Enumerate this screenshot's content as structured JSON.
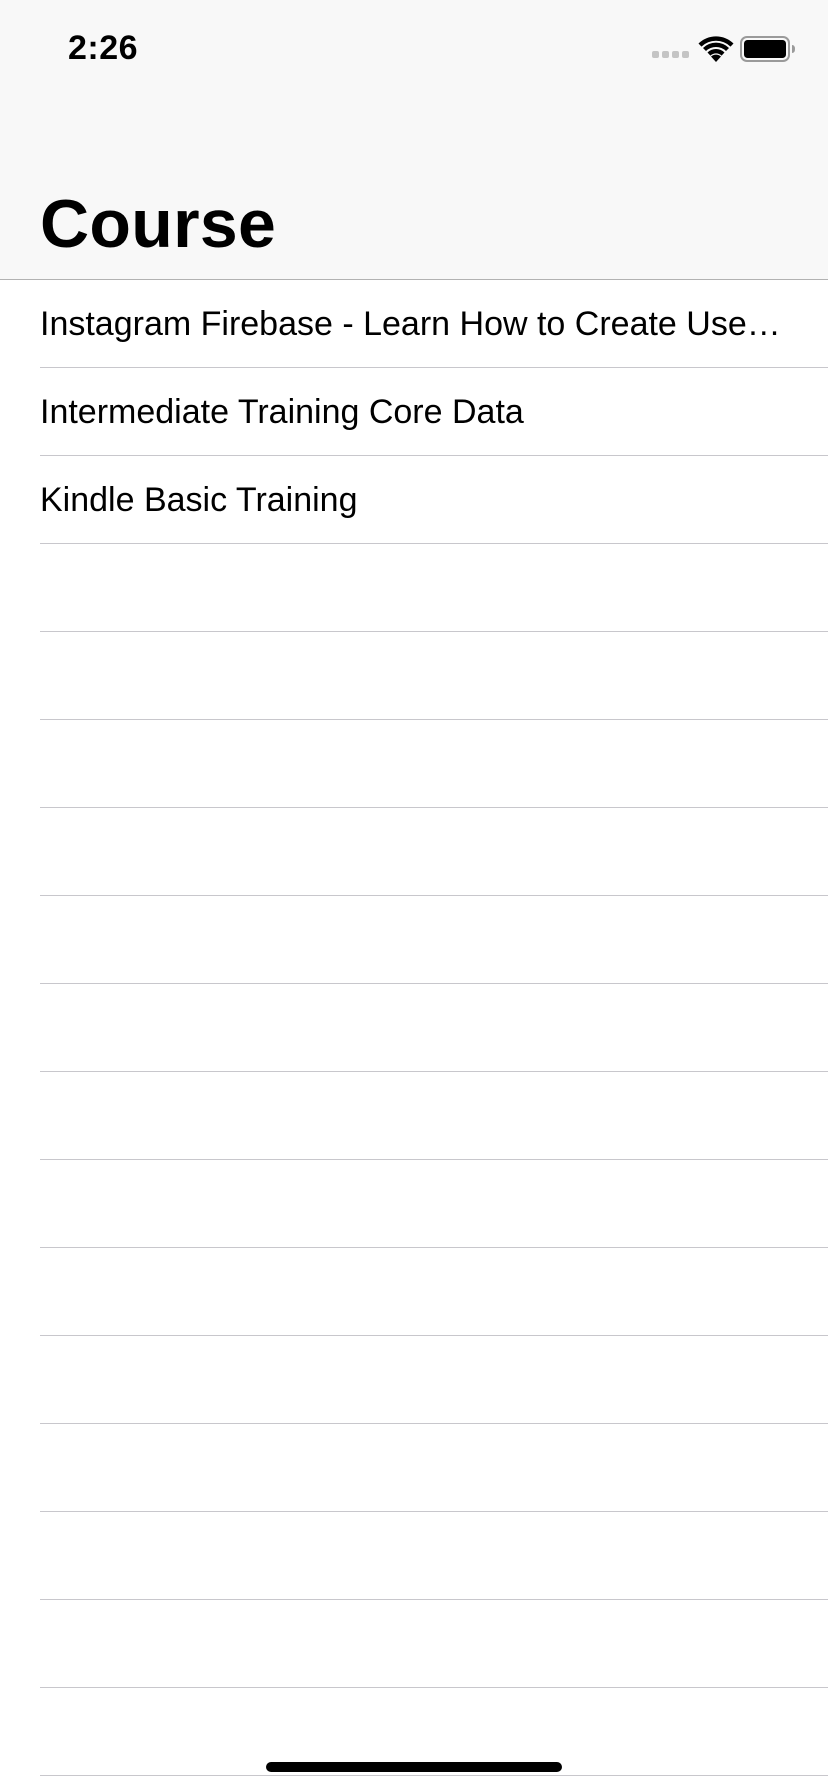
{
  "status_bar": {
    "time": "2:26",
    "icons": [
      "signal-dots-icon",
      "wifi-icon",
      "battery-icon"
    ]
  },
  "nav": {
    "title": "Course"
  },
  "courses": [
    "Instagram Firebase - Learn How to Create Users, Follow, and Send Push Notifications",
    "Intermediate Training Core Data",
    "Kindle Basic Training"
  ],
  "empty_row_count": 14,
  "colors": {
    "nav_background": "#f8f8f8",
    "separator": "#c8c7cc",
    "nav_border": "#b2b2b2",
    "text": "#000000"
  }
}
